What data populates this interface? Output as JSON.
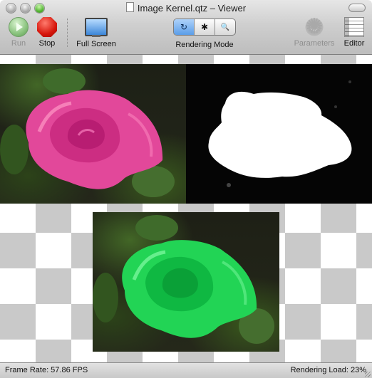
{
  "window": {
    "title": "Image Kernel.qtz – Viewer"
  },
  "toolbar": {
    "run_label": "Run",
    "stop_label": "Stop",
    "full_screen_label": "Full Screen",
    "rendering_mode_label": "Rendering Mode",
    "rendering_mode_segments": [
      "↻",
      "✱",
      "🔍"
    ],
    "parameters_label": "Parameters",
    "editor_label": "Editor"
  },
  "status": {
    "frame_rate": "Frame Rate:  57.86 FPS",
    "rendering_load": "Rendering Load: 23%"
  },
  "colors": {
    "rose_pink": "#e8509a",
    "rose_green": "#22d455",
    "mask_white": "#ffffff",
    "checker_gray": "#c9c9c9",
    "segment_active": "#5b9de8"
  }
}
